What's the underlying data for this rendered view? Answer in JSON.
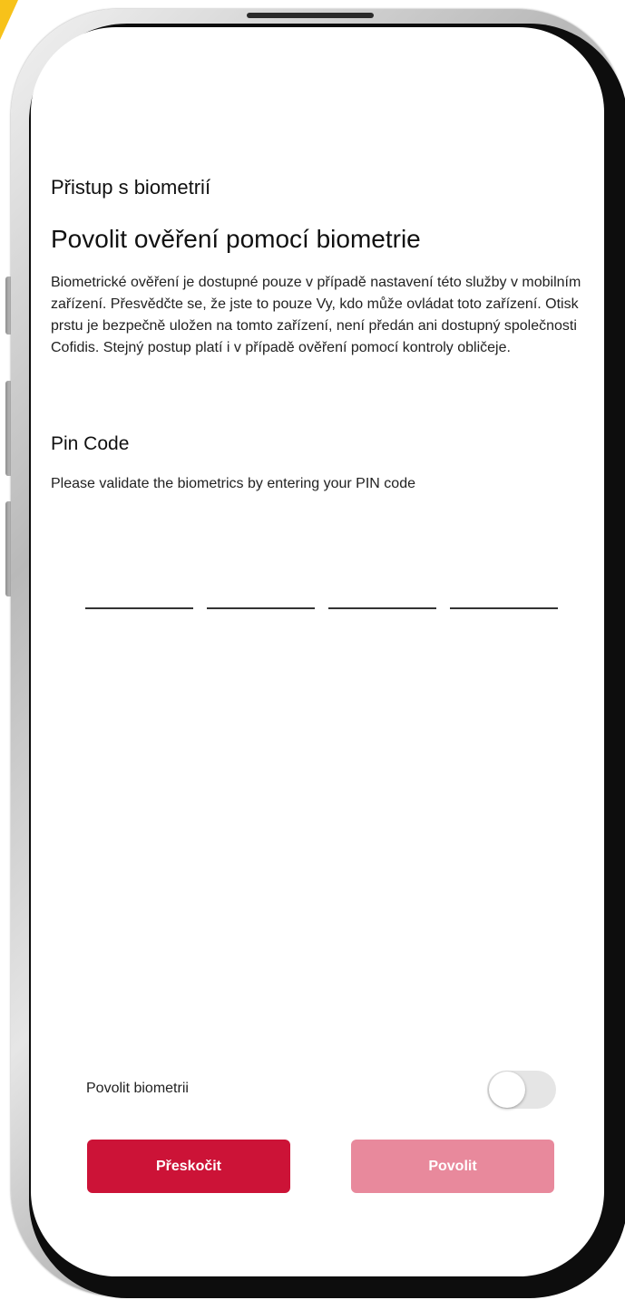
{
  "screen": {
    "title": "Přistup s biometrií",
    "heading": "Povolit ověření pomocí biometrie",
    "description": "Biometrické ověření je dostupné pouze v případě nastavení této služby v mobilním zařízení. Přesvědčte se, že jste to pouze Vy, kdo může ovládat toto zařízení. Otisk prstu je bezpečně uložen na tomto zařízení, není předán ani dostupný společnosti Cofidis. Stejný postup platí i v případě ověření pomocí kontroly obličeje."
  },
  "pin": {
    "title": "Pin Code",
    "subtitle": "Please validate the biometrics by entering your PIN code",
    "digits": [
      "",
      "",
      "",
      ""
    ]
  },
  "biometrics_toggle": {
    "label": "Povolit biometrii",
    "enabled": false
  },
  "buttons": {
    "skip_label": "Přeskočit",
    "allow_label": "Povolit"
  },
  "colors": {
    "primary": "#cc1337",
    "primary_disabled": "#e8899c",
    "accent_corner": "#f7c21a"
  }
}
